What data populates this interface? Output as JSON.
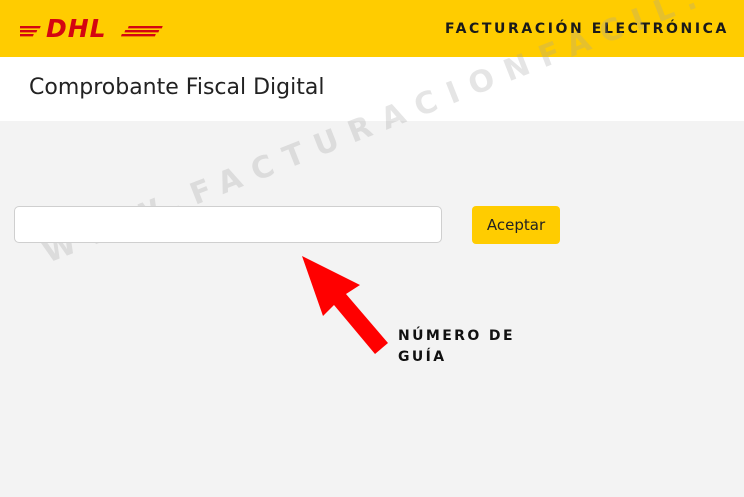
{
  "header": {
    "logo_text": "DHL",
    "title": "FACTURACIÓN ELECTRÓNICA"
  },
  "page": {
    "title": "Comprobante Fiscal Digital"
  },
  "form": {
    "guia_input": {
      "value": "",
      "placeholder": ""
    },
    "accept_label": "Aceptar"
  },
  "annotation": {
    "text": "NÚMERO DE GUÍA"
  },
  "watermark": {
    "text": "WWW.FACTURACIONFACIL.COM.MX"
  },
  "colors": {
    "brand_yellow": "#ffcc00",
    "brand_red": "#d40511",
    "arrow_red": "#ff0000",
    "background": "#f3f3f3"
  },
  "icons": {
    "logo": "dhl-logo",
    "arrow": "pointer-arrow-icon"
  }
}
